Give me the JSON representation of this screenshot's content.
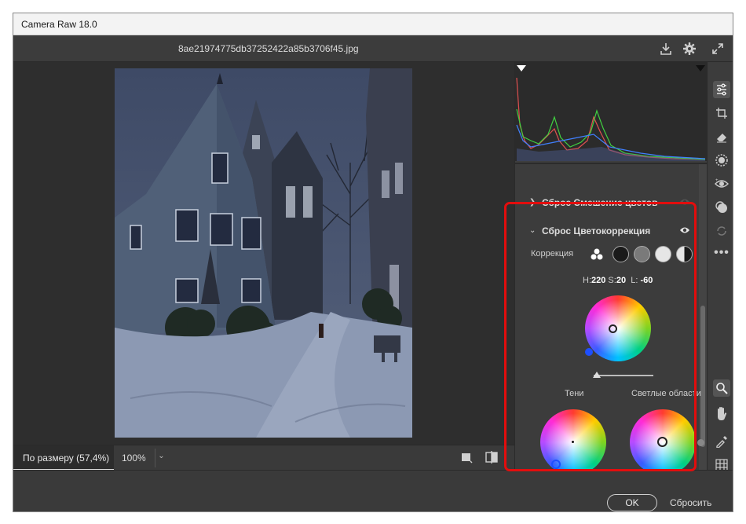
{
  "window": {
    "title": "Camera Raw 18.0"
  },
  "topbar": {
    "filename": "8ae21974775db37252422a85b3706f45.jpg"
  },
  "statusbar": {
    "zoom_fit_label": "По размеру (57,4%)",
    "zoom_100_label": "100%"
  },
  "panel": {
    "sections": [
      {
        "label": "Сброс Смешение цветов",
        "expanded": false
      },
      {
        "label": "Сброс Цветокоррекция",
        "expanded": true
      }
    ],
    "grading": {
      "correction_label": "Коррекция",
      "h_label": "H:",
      "h_value": "220",
      "s_label": "S:",
      "s_value": "20",
      "l_label": "L:",
      "l_value": "-60",
      "shadows_label": "Тени",
      "highlights_label": "Светлые области"
    }
  },
  "footer": {
    "ok_label": "OK",
    "reset_label": "Сбросить"
  },
  "colors": {
    "highlight_box": "#e30d0d",
    "panel_bg": "#3c3c3c",
    "canvas_bg": "#2e2e2e"
  },
  "icons": [
    "save-icon",
    "gear-icon",
    "fullscreen-icon",
    "edit-sliders-icon",
    "crop-icon",
    "eraser-icon",
    "mask-icon",
    "redeye-icon",
    "presets-icon",
    "snapshot-icon",
    "more-icon",
    "zoom-icon",
    "hand-icon",
    "color-sampler-icon",
    "grid-icon",
    "eye-icon",
    "before-after-icon",
    "compare-icon"
  ]
}
